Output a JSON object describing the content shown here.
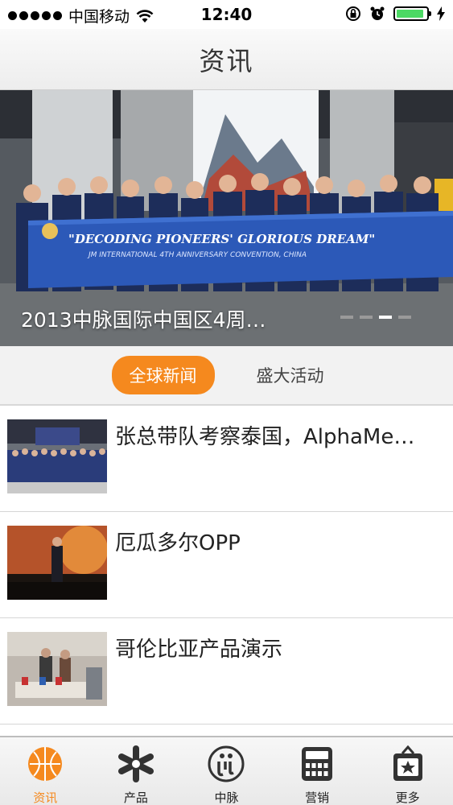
{
  "status_bar": {
    "carrier": "中国移动",
    "time": "12:40",
    "battery_level": 0.92,
    "battery_color": "#4cd964"
  },
  "nav": {
    "title": "资讯"
  },
  "banner": {
    "caption": "2013中脉国际中国区4周…",
    "banner_line1": "\"DECODING PIONEERS' GLORIOUS DREAM\"",
    "banner_line2": "JM INTERNATIONAL 4TH ANNIVERSARY CONVENTION, CHINA",
    "page_count": 4,
    "active_page": 3
  },
  "segments": [
    {
      "label": "全球新闻",
      "active": true
    },
    {
      "label": "盛大活动",
      "active": false
    }
  ],
  "news": [
    {
      "title": "张总带队考察泰国，AlphaMe…",
      "thumb": "group-photo"
    },
    {
      "title": "厄瓜多尔OPP",
      "thumb": "stage-speaker"
    },
    {
      "title": "哥伦比亚产品演示",
      "thumb": "product-demo"
    }
  ],
  "tabs": [
    {
      "label": "资讯",
      "icon": "news-ball-icon",
      "active": true
    },
    {
      "label": "产品",
      "icon": "product-asterisk-icon",
      "active": false
    },
    {
      "label": "中脉",
      "icon": "jm-logo-icon",
      "active": false
    },
    {
      "label": "营销",
      "icon": "calculator-icon",
      "active": false
    },
    {
      "label": "更多",
      "icon": "more-bag-icon",
      "active": false
    }
  ],
  "colors": {
    "accent": "#f5891e",
    "banner_blue": "#2c59b8"
  }
}
